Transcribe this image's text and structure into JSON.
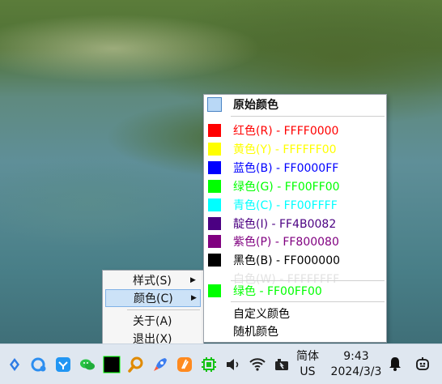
{
  "context_menu": {
    "items": [
      {
        "label": "样式(S)",
        "has_submenu": true
      },
      {
        "label": "颜色(C)",
        "has_submenu": true,
        "selected": true
      },
      {
        "label": "关于(A)"
      },
      {
        "label": "退出(X)"
      }
    ]
  },
  "color_submenu": {
    "header": {
      "label": "原始颜色",
      "swatch": "#b9d8f6"
    },
    "items": [
      {
        "label": "红色(R) - FFFF0000",
        "color": "#ff0000"
      },
      {
        "label": "黄色(Y) - FFFFFF00",
        "color": "#ffff00"
      },
      {
        "label": "蓝色(B) - FF0000FF",
        "color": "#0000ff"
      },
      {
        "label": "绿色(G) - FF00FF00",
        "color": "#00ff00"
      },
      {
        "label": "青色(C) - FF00FFFF",
        "color": "#00ffff"
      },
      {
        "label": "靛色(I) - FF4B0082",
        "color": "#4b0082"
      },
      {
        "label": "紫色(P) - FF800080",
        "color": "#800080"
      },
      {
        "label": "黑色(B) - FF000000",
        "color": "#000000"
      },
      {
        "label": "白色(W) - FFFFFFFF",
        "color": "#ffffff",
        "text_color": "#e2e2e2"
      }
    ],
    "current": {
      "label": "绿色 - FF00FF00",
      "color": "#00ff00"
    },
    "actions": [
      {
        "label": "自定义颜色"
      },
      {
        "label": "随机颜色"
      }
    ]
  },
  "taskbar": {
    "icons": [
      "launcher-icon",
      "browser-icon",
      "store-icon",
      "wechat-icon",
      "black-square-icon",
      "search-icon",
      "rocket-icon",
      "app-icon",
      "chip-icon",
      "volume-icon",
      "wifi-icon",
      "battery-icon"
    ],
    "ime": {
      "line1": "简体",
      "line2": "US"
    },
    "clock": {
      "time": "9:43",
      "date": "2024/3/3"
    }
  }
}
